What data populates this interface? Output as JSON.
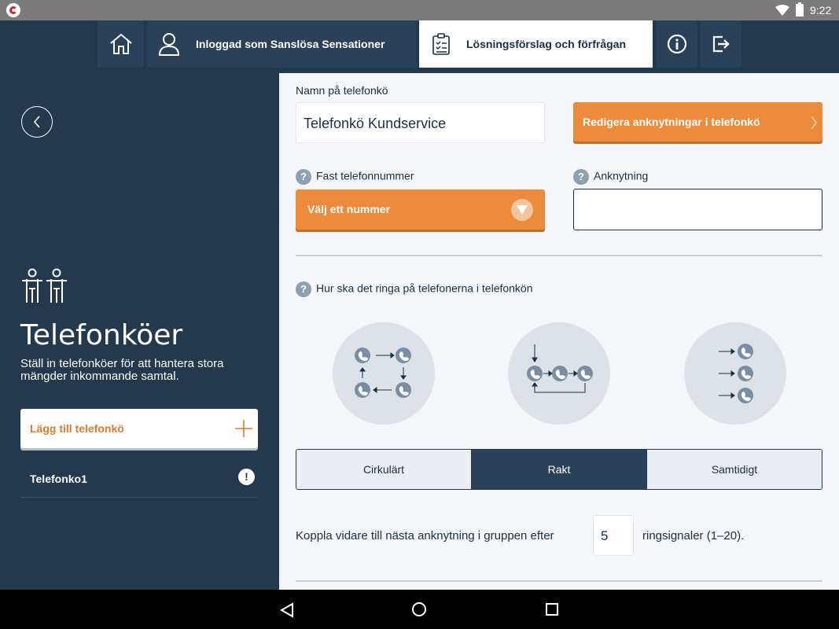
{
  "status_bar": {
    "time": "9:22"
  },
  "top_nav": {
    "user_label": "Inloggad som Sanslösa Sensationer",
    "solution_label": "Lösningsförslag och förfrågan"
  },
  "sidebar": {
    "title": "Telefonköer",
    "description": "Ställ in telefonköer för att hantera stora mängder inkommande samtal.",
    "add_button_label": "Lägg till telefonkö",
    "queues": [
      {
        "name": "Telefonko1",
        "warning": "!"
      }
    ]
  },
  "form": {
    "name_label": "Namn på telefonkö",
    "name_value": "Telefonkö Kundservice",
    "edit_button_label": "Redigera anknytningar i telefonkö",
    "fixed_number_label": "Fast telefonnummer",
    "fixed_number_value": "Välj ett nummer",
    "extension_label": "Anknytning",
    "extension_value": "",
    "help_mark": "?",
    "ring_label": "Hur ska det ringa på telefonerna i telefonkön",
    "ring_modes": [
      "Cirkulärt",
      "Rakt",
      "Samtidigt"
    ],
    "active_ring_mode": "Rakt",
    "forward_text_before": "Koppla vidare till nästa anknytning i gruppen efter",
    "forward_rings_value": "5",
    "forward_text_after": "ringsignaler (1–20)."
  },
  "colors": {
    "dark_navy": "#23394e",
    "orange": "#ed8b3c",
    "orange_text": "#e0792b",
    "light_bg": "#f4f6f9"
  }
}
